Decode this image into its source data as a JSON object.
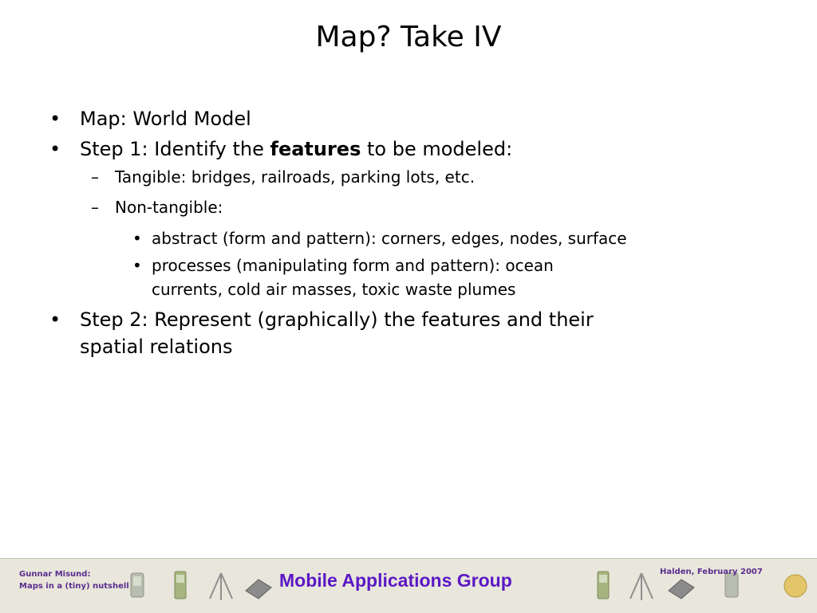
{
  "slide": {
    "title": "Map? Take IV",
    "items": [
      {
        "bullet": "•",
        "text": "Map: World Model"
      },
      {
        "bullet": "•",
        "prefix": "Step 1: Identify the ",
        "bold": "features",
        "suffix": " to be modeled:"
      },
      {
        "bullet": "–",
        "text": "Tangible: bridges, railroads, parking lots, etc."
      },
      {
        "bullet": "–",
        "text": "Non-tangible:"
      },
      {
        "bullet": "•",
        "text": "abstract (form and pattern): corners, edges, nodes, surface"
      },
      {
        "bullet": "•",
        "line1": "processes (manipulating form and pattern): ocean",
        "line2": "currents, cold air masses, toxic waste plumes"
      },
      {
        "bullet": "•",
        "line1": "Step 2: Represent (graphically) the features and their",
        "line2": "spatial relations"
      }
    ]
  },
  "footer": {
    "left_line1": "Gunnar Misund:",
    "left_line2": "Maps in a (tiny) nutshell",
    "center": "Mobile Applications Group",
    "right": "Halden, February 2007",
    "decor_icons": [
      "pda-icon",
      "tripod-icon",
      "phone-icon",
      "laptop-icon",
      "globe-icon"
    ]
  }
}
